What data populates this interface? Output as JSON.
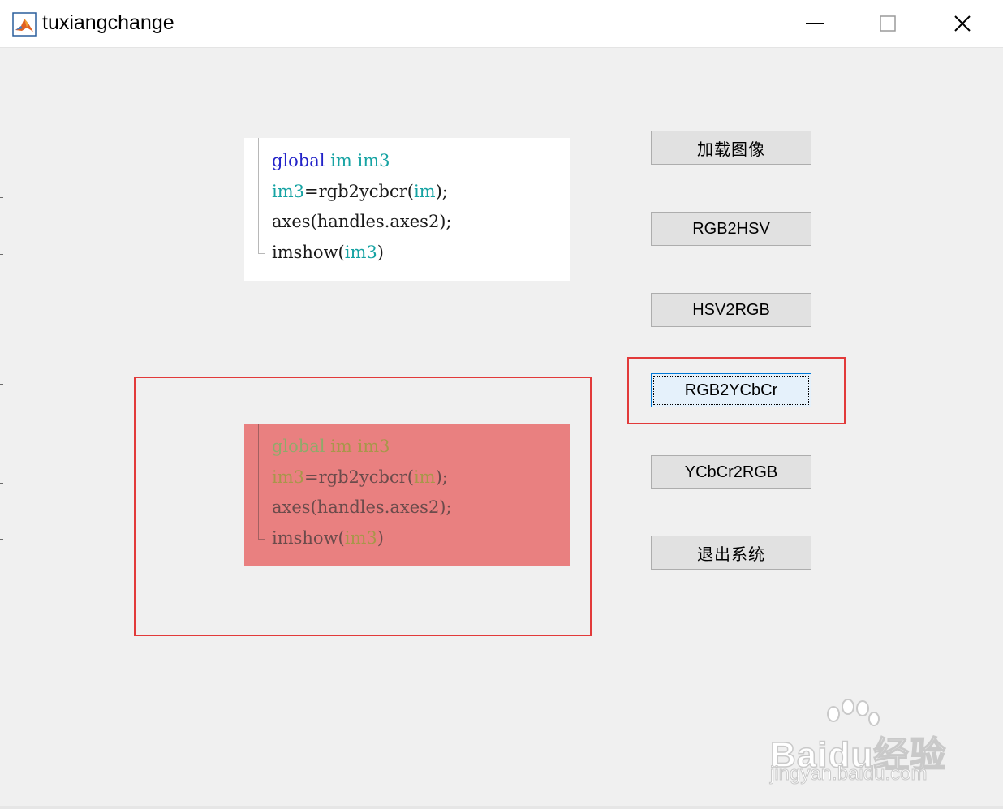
{
  "window": {
    "title": "tuxiangchange"
  },
  "code_top": {
    "lines": [
      [
        {
          "t": "global",
          "c": "kw"
        },
        {
          "t": " ",
          "c": "txt"
        },
        {
          "t": "im",
          "c": "var"
        },
        {
          "t": " ",
          "c": "txt"
        },
        {
          "t": "im3",
          "c": "var"
        }
      ],
      [
        {
          "t": "im3",
          "c": "var"
        },
        {
          "t": "=rgb2ycbcr(",
          "c": "txt"
        },
        {
          "t": "im",
          "c": "var"
        },
        {
          "t": ");",
          "c": "txt"
        }
      ],
      [
        {
          "t": "axes(handles.axes2);",
          "c": "txt"
        }
      ],
      [
        {
          "t": "imshow(",
          "c": "txt"
        },
        {
          "t": "im3",
          "c": "var"
        },
        {
          "t": ")",
          "c": "txt"
        }
      ]
    ]
  },
  "code_bottom": {
    "lines": [
      [
        {
          "t": "global",
          "c": "kw"
        },
        {
          "t": " ",
          "c": "txt"
        },
        {
          "t": "im",
          "c": "var"
        },
        {
          "t": " ",
          "c": "txt"
        },
        {
          "t": "im3",
          "c": "var"
        }
      ],
      [
        {
          "t": "im3",
          "c": "var"
        },
        {
          "t": "=rgb2ycbcr(",
          "c": "txt"
        },
        {
          "t": "im",
          "c": "var"
        },
        {
          "t": ");",
          "c": "txt"
        }
      ],
      [
        {
          "t": "axes(handles.axes2);",
          "c": "txt"
        }
      ],
      [
        {
          "t": "imshow(",
          "c": "txt"
        },
        {
          "t": "im3",
          "c": "var"
        },
        {
          "t": ")",
          "c": "txt"
        }
      ]
    ]
  },
  "buttons": {
    "load_image": "加载图像",
    "rgb2hsv": "RGB2HSV",
    "hsv2rgb": "HSV2RGB",
    "rgb2ycbcr": "RGB2YCbCr",
    "ycbcr2rgb": "YCbCr2RGB",
    "exit_system": "退出系统"
  },
  "watermark": {
    "brand": "Baidu经验",
    "url": "jingyan.baidu.com"
  },
  "colors": {
    "highlight_border": "#e23a3a",
    "code_highlight_bg": "#e98080",
    "focus_border": "#0078d7"
  }
}
